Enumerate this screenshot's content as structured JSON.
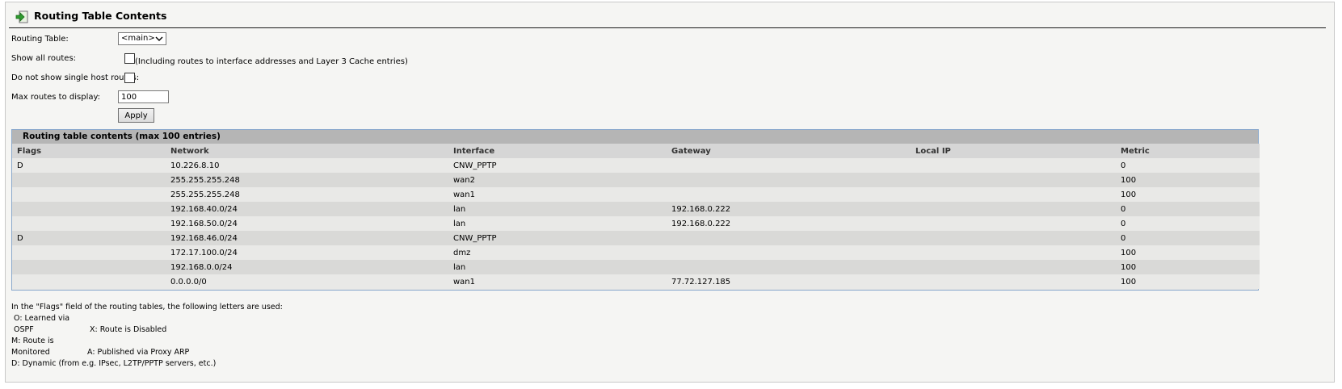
{
  "header": {
    "title": "Routing Table Contents"
  },
  "form": {
    "routing_table_label": "Routing Table:",
    "routing_table_value": "<main>",
    "show_all_label": "Show all routes:",
    "show_all_hint": "(Including routes to interface addresses and Layer 3 Cache entries)",
    "no_single_host_label": "Do not show single host routes:",
    "max_routes_label": "Max routes to display:",
    "max_routes_value": "100",
    "apply_label": "Apply"
  },
  "table": {
    "caption": "Routing table contents (max 100 entries)",
    "columns": [
      "Flags",
      "Network",
      "Interface",
      "Gateway",
      "Local IP",
      "Metric"
    ],
    "rows": [
      [
        "D",
        "10.226.8.10",
        "CNW_PPTP",
        "",
        "",
        "0"
      ],
      [
        "",
        "255.255.255.248",
        "wan2",
        "",
        "",
        "100"
      ],
      [
        "",
        "255.255.255.248",
        "wan1",
        "",
        "",
        "100"
      ],
      [
        "",
        "192.168.40.0/24",
        "lan",
        "192.168.0.222",
        "",
        "0"
      ],
      [
        "",
        "192.168.50.0/24",
        "lan",
        "192.168.0.222",
        "",
        "0"
      ],
      [
        "D",
        "192.168.46.0/24",
        "CNW_PPTP",
        "",
        "",
        "0"
      ],
      [
        "",
        "172.17.100.0/24",
        "dmz",
        "",
        "",
        "100"
      ],
      [
        "",
        "192.168.0.0/24",
        "lan",
        "",
        "",
        "100"
      ],
      [
        "",
        "0.0.0.0/0",
        "wan1",
        "77.72.127.185",
        "",
        "100"
      ]
    ]
  },
  "legend": {
    "intro": "In the \"Flags\" field of the routing tables, the following letters are used:",
    "o": "O: Learned via OSPF",
    "x": "X: Route is Disabled",
    "m": "M: Route is Monitored",
    "a": "A: Published via Proxy ARP",
    "d": "D: Dynamic (from e.g. IPsec, L2TP/PPTP servers, etc.)"
  },
  "icons": {
    "title_icon": "green-arrow-enter-icon",
    "select_chevron": "chevron-down-icon"
  },
  "colors": {
    "frame_bg": "#f5f5f3",
    "caption_bg": "#b5b5b5",
    "header_bg": "#d6d6d6",
    "table_border": "#8aa8cc",
    "icon_green": "#2e9a2e"
  }
}
